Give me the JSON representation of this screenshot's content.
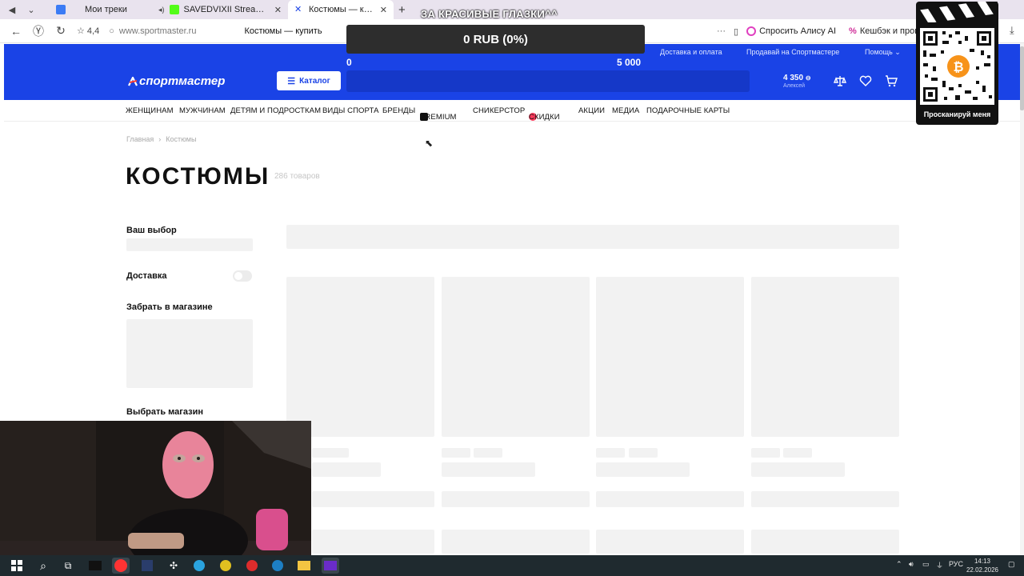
{
  "browser": {
    "tabs": [
      {
        "title": "Мои треки",
        "favicon_color": "#3b7bf5"
      },
      {
        "title": "SAVEDVIXII Stream - Watc",
        "favicon_color": "#53fc18"
      },
      {
        "title": "Костюмы — купить с д",
        "favicon_color": "#1a43e6",
        "active": true
      }
    ],
    "rating": "4,4",
    "url": "www.sportmaster.ru",
    "page_title": "Костюмы — купить",
    "alice_label": "Спросить Алису AI",
    "cashback_label": "Кешбэк и пром"
  },
  "stream_overlay": {
    "caption": "ЗА КРАСИВЫЕ ГЛАЗКИ^^",
    "donation_goal": "0 RUB (0%)",
    "goal_min": "0",
    "goal_max": "5 000",
    "qr_caption": "Просканируй меня"
  },
  "site": {
    "logo": "спортмастер",
    "top_links": [
      "Доставка и оплата",
      "Продавай на Спортмастере",
      "Помощь"
    ],
    "catalog_label": "Каталог",
    "bonus_amount": "4 350",
    "bonus_user": "Алексей",
    "categories": [
      "ЖЕНЩИНАМ",
      "МУЖЧИНАМ",
      "ДЕТЯМ И ПОДРОСТКАМ",
      "ВИДЫ СПОРТА",
      "БРЕНДЫ",
      "PREMIUM",
      "СНИКЕРСТОР",
      "СКИДКИ",
      "АКЦИИ",
      "МЕДИА",
      "ПОДАРОЧНЫЕ КАРТЫ"
    ],
    "breadcrumbs": [
      "Главная",
      "Костюмы"
    ],
    "heading": "КОСТЮМЫ",
    "product_count": "286 товаров",
    "filters": {
      "your_choice": "Ваш выбор",
      "delivery": "Доставка",
      "pickup": "Забрать в магазине",
      "choose_store": "Выбрать магазин"
    },
    "accent_color": "#1a43e6"
  },
  "taskbar": {
    "language": "РУС",
    "time": "14:13",
    "date": "22.02.2026"
  }
}
